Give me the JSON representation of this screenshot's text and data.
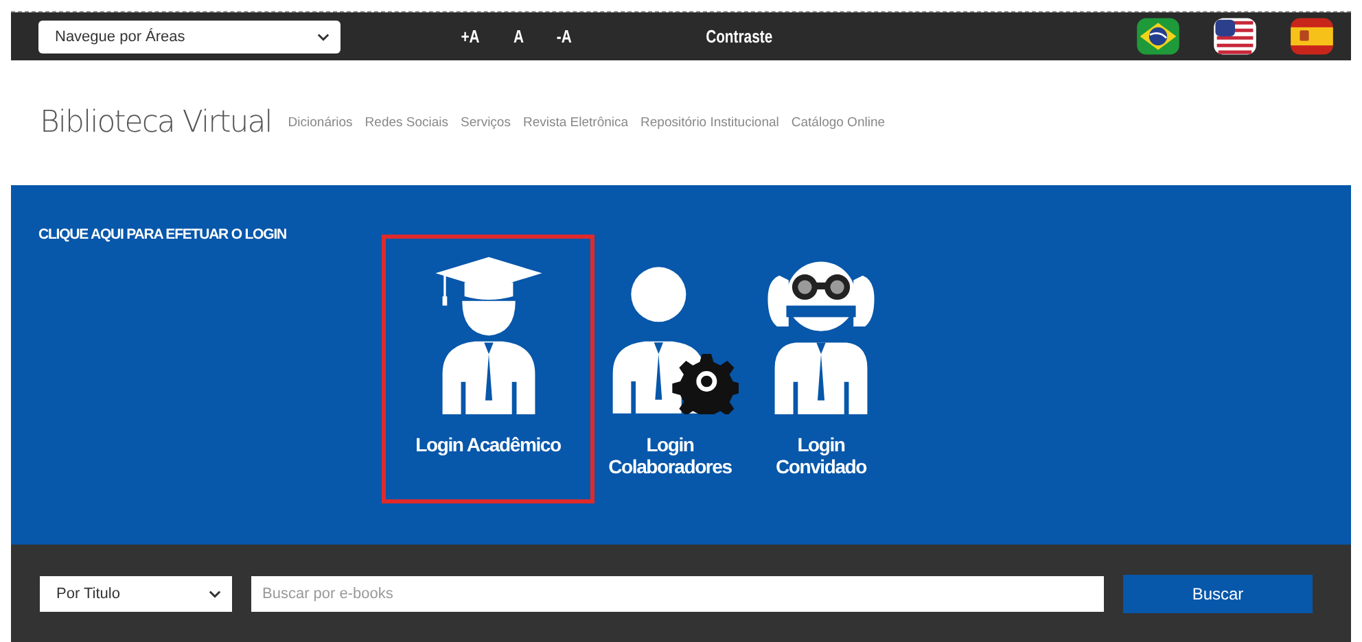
{
  "top_bar": {
    "area_select": {
      "value": "Navegue por Áreas"
    },
    "font_controls": [
      "+A",
      "A",
      "-A"
    ],
    "contrast": "Contraste"
  },
  "header": {
    "title": "Biblioteca Virtual",
    "nav": [
      "Dicionários",
      "Redes Sociais",
      "Serviços",
      "Revista Eletrônica",
      "Repositório Institucional",
      "Catálogo Online"
    ]
  },
  "login": {
    "heading": "CLIQUE AQUI PARA EFETUAR O LOGIN",
    "options": [
      {
        "kind": "academic",
        "label": "Login Acadêmico",
        "selected": true
      },
      {
        "kind": "staff",
        "label": "Login Colaboradores",
        "selected": false
      },
      {
        "kind": "guest",
        "label": "Login Convidado",
        "selected": false
      }
    ]
  },
  "search": {
    "filter_select": {
      "value": "Por Titulo"
    },
    "placeholder": "Buscar por e-books",
    "button": "Buscar"
  }
}
